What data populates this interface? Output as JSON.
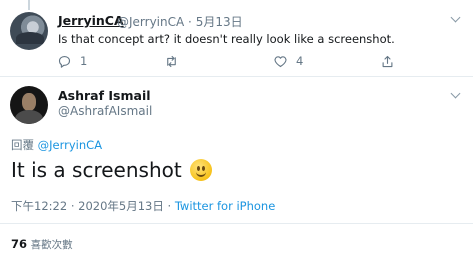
{
  "reply_tweet": {
    "display_name": "JerryinCA",
    "handle": "@JerryinCA",
    "separator": "·",
    "date": "5月13日",
    "text": "Is that concept art? it doesn't really look like a screenshot.",
    "actions": {
      "reply_count": "1",
      "retweet_count": "",
      "like_count": "4"
    }
  },
  "main_tweet": {
    "display_name": "Ashraf Ismail",
    "handle": "@AshrafAIsmail",
    "replying_label": "回覆",
    "replying_to": "@JerryinCA",
    "text": "It is a screenshot",
    "time": "下午12:22",
    "separator": "·",
    "date": "2020年5月13日",
    "source": "Twitter for iPhone",
    "like_count": "76",
    "like_label": "喜歡次數"
  },
  "colors": {
    "link": "#1b95e0",
    "muted": "#657786",
    "divider": "#e6ecf0"
  },
  "icons": [
    "reply-icon",
    "retweet-icon",
    "heart-icon",
    "share-icon",
    "chevron-down-icon",
    "smiley-emoji"
  ]
}
